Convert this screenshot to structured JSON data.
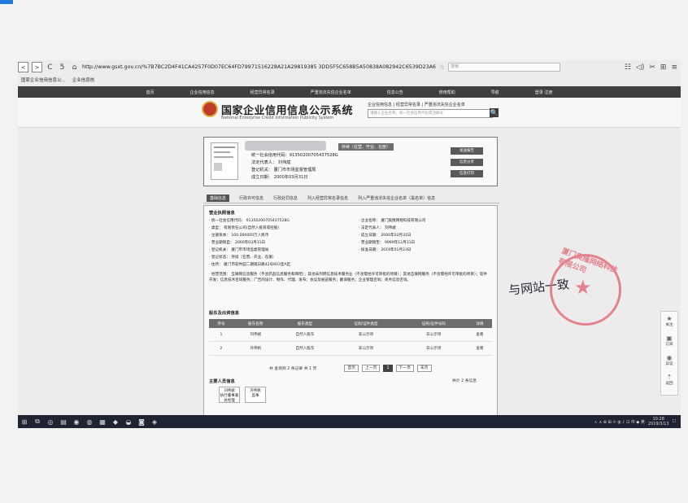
{
  "browser": {
    "nav_back": "<",
    "nav_forward": ">",
    "refresh_icon": "C",
    "undo_icon": "5",
    "home_icon": "⌂",
    "url": "http://www.gsxt.gov.cn/%7B7BC2D4F41CA4257F0D07EC64FD79971516228A21A29819385 3DD5F5C658B5A50838A082942C6539D23A6",
    "star_icon": "☆",
    "search_box_placeholder": "搜索",
    "tools": [
      "☷",
      "◁)",
      "✂",
      "⊞",
      "≡"
    ],
    "favorites": [
      "国家企业信用信息公...",
      "企业信息核"
    ]
  },
  "site": {
    "nav_items": [
      "首页",
      "企业信用信息",
      "经营异常名录",
      "严重违法失信企业名单",
      "信息公告",
      "使用帮助",
      "导航",
      "登录 注册"
    ],
    "title_cn": "国家企业信用信息公示系统",
    "title_en": "National Enterprise Credit Information Publicity System",
    "search_tabs": "企业信用信息 | 经营异常名录 | 严重违法失信企业名单",
    "search_placeholder": "请输入企业名称、统一社会信用代码或注册号",
    "search_button": "🔍"
  },
  "company": {
    "status": "存续（在营、开业、在册）",
    "code_line": "统一社会信用代码：91350200705437528G",
    "legal_rep": "法定代表人：  刘伟斌",
    "reg_authority": "登记机关：  厦门市市场监督管理局",
    "established": "成立日期：  2000年03月31日",
    "buttons": [
      "发送报告",
      "信息分享",
      "信息打印"
    ]
  },
  "tabs": [
    "基础信息",
    "行政许可信息",
    "行政处罚信息",
    "列入经营异常名录信息",
    "列入严重违法失信企业名单（黑名单）信息"
  ],
  "detail": {
    "section_basic": "营业执照信息",
    "fields_left": [
      "· 统一社会信用代码：  91350200705437528G",
      "· 类型：  有限责任公司(自然人投资或控股)",
      "· 注册资本：  100.000000万人民币",
      "· 营业期限自：  2000年03月31日",
      "· 登记机关：  厦门市市场监督管理局",
      "· 登记状态：  存续（在营、开业、在册）",
      "· 住所：  厦门市软件园二期观日路42号603室A区"
    ],
    "fields_right": [
      "· 企业名称：  厦门奥隆网络科技有限公司",
      "· 法定代表人：  刘伟斌",
      "· 成立日期：  2000年03月31日",
      "· 营业期限至：  9999年12月31日",
      "· 核准日期：  2019年01月23日"
    ],
    "business_scope": "· 经营范围：  互联网信息服务（不含药品信息服务和网吧）；其他未列明信息技术服务业（不含需经许可审批的项目）；其他互联网服务（不含需经许可审批的项目）；软件开发；信息技术咨询服务；广告的设计、制作、代理、发布；会议及展览服务；翻译服务；企业管理咨询；商务信息咨询。",
    "section_shareholders": "股东及出资信息",
    "shareholder_headers": [
      "序号",
      "股东名称",
      "股东类型",
      "证照/证件类型",
      "证照/证件号码",
      "详情"
    ],
    "shareholders": [
      [
        "1",
        "刘伟斌",
        "自然人股东",
        "非公示项",
        "非公示项",
        "查看"
      ],
      [
        "2",
        "许伟帆",
        "自然人股东",
        "非公示项",
        "非公示项",
        "查看"
      ]
    ],
    "pager": {
      "summary": "共 查询到 2 条记录 共 1 页",
      "first": "首页",
      "prev": "上一页",
      "current": "1",
      "next": "下一页",
      "last": "末页"
    },
    "section_managers": "主要人员信息",
    "managers_count": "共计 2 条信息",
    "managers": [
      [
        "刘伟斌",
        "执行董事兼总经理"
      ],
      [
        "许伟帆",
        "监事"
      ]
    ]
  },
  "side_panel": [
    {
      "icon": "★",
      "label": "关注"
    },
    {
      "icon": "▣",
      "label": "订阅"
    },
    {
      "icon": "◉",
      "label": "异议"
    },
    {
      "icon": "⇡",
      "label": "返回"
    }
  ],
  "taskbar": {
    "icons": [
      "⊞",
      "⧉",
      "◎",
      "▤",
      "◉",
      "◍",
      "▦",
      "◆",
      "◒",
      "◙",
      "◈"
    ],
    "tray_text": "ㅅ ∧ ⊕ ⊞ ☼ ◍ ♪ ⊡ 中 ◆ 英",
    "time": "10:28",
    "date": "2019/3/13",
    "notify_icon": "☐"
  },
  "handwriting": "与网站一致",
  "seal": {
    "text": "厦门奥隆网络科技有限公司",
    "mark": "★"
  }
}
